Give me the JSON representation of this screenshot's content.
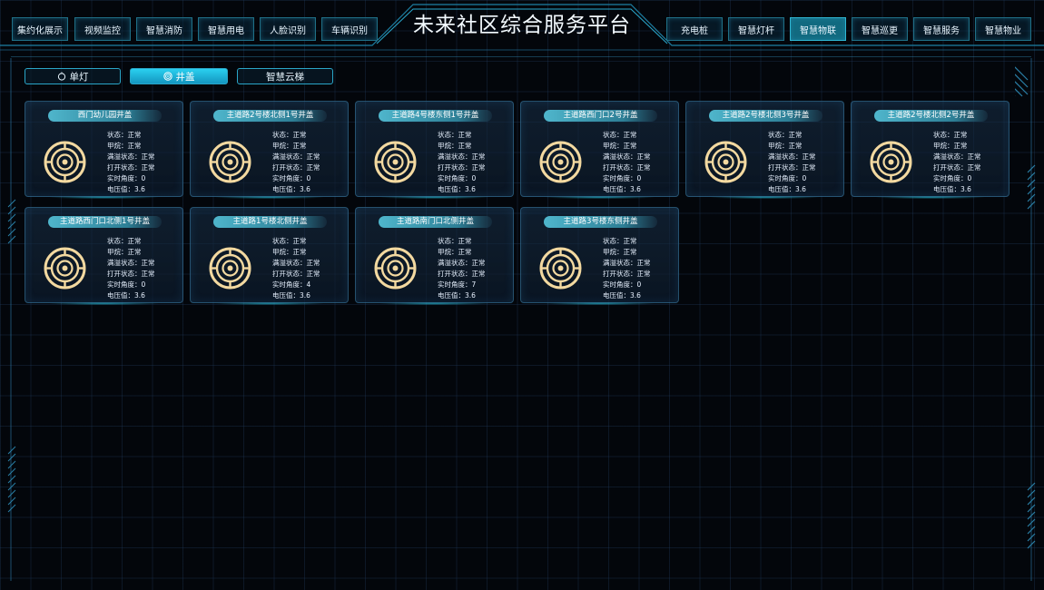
{
  "app": {
    "title": "未来社区综合服务平台",
    "nav_left": [
      "集约化展示",
      "视频监控",
      "智慧消防",
      "智慧用电",
      "人脸识别",
      "车辆识别"
    ],
    "nav_right": [
      "充电桩",
      "智慧灯杆",
      "智慧物联",
      "智慧巡更",
      "智慧服务",
      "智慧物业"
    ],
    "active_nav": "智慧物联"
  },
  "sub_tabs": [
    {
      "label": "单灯",
      "icon": "bulb-icon"
    },
    {
      "label": "井盖",
      "icon": "manhole-icon",
      "active": true
    },
    {
      "label": "智慧云梯",
      "icon": ""
    }
  ],
  "field_labels": {
    "status": "状态：",
    "battery": "甲烷：",
    "overflow": "满溢状态：",
    "open": "打开状态：",
    "angle": "实时角度：",
    "voltage": "电压值："
  },
  "cards": [
    {
      "name": "西门幼儿园井盖",
      "status": "正常",
      "battery": "正常",
      "overflow": "正常",
      "open": "正常",
      "angle": "0",
      "voltage": "3.6"
    },
    {
      "name": "主道路2号楼北侧1号井盖",
      "status": "正常",
      "battery": "正常",
      "overflow": "正常",
      "open": "正常",
      "angle": "0",
      "voltage": "3.6"
    },
    {
      "name": "主道路4号楼东侧1号井盖",
      "status": "正常",
      "battery": "正常",
      "overflow": "正常",
      "open": "正常",
      "angle": "0",
      "voltage": "3.6"
    },
    {
      "name": "主道路西门口2号井盖",
      "status": "正常",
      "battery": "正常",
      "overflow": "正常",
      "open": "正常",
      "angle": "0",
      "voltage": "3.6"
    },
    {
      "name": "主道路2号楼北侧3号井盖",
      "status": "正常",
      "battery": "正常",
      "overflow": "正常",
      "open": "正常",
      "angle": "0",
      "voltage": "3.6"
    },
    {
      "name": "主道路2号楼北侧2号井盖",
      "status": "正常",
      "battery": "正常",
      "overflow": "正常",
      "open": "正常",
      "angle": "0",
      "voltage": "3.6"
    },
    {
      "name": "主道路西门口北侧1号井盖",
      "status": "正常",
      "battery": "正常",
      "overflow": "正常",
      "open": "正常",
      "angle": "0",
      "voltage": "3.6"
    },
    {
      "name": "主道路1号楼北侧井盖",
      "status": "正常",
      "battery": "正常",
      "overflow": "正常",
      "open": "正常",
      "angle": "4",
      "voltage": "3.6"
    },
    {
      "name": "主道路南门口北侧井盖",
      "status": "正常",
      "battery": "正常",
      "overflow": "正常",
      "open": "正常",
      "angle": "7",
      "voltage": "3.6"
    },
    {
      "name": "主道路3号楼东侧井盖",
      "status": "正常",
      "battery": "正常",
      "overflow": "正常",
      "open": "正常",
      "angle": "0",
      "voltage": "3.6"
    }
  ],
  "colors": {
    "accent": "#2ad0ef",
    "icon": "#f3d9a0",
    "background": "#03060b"
  }
}
